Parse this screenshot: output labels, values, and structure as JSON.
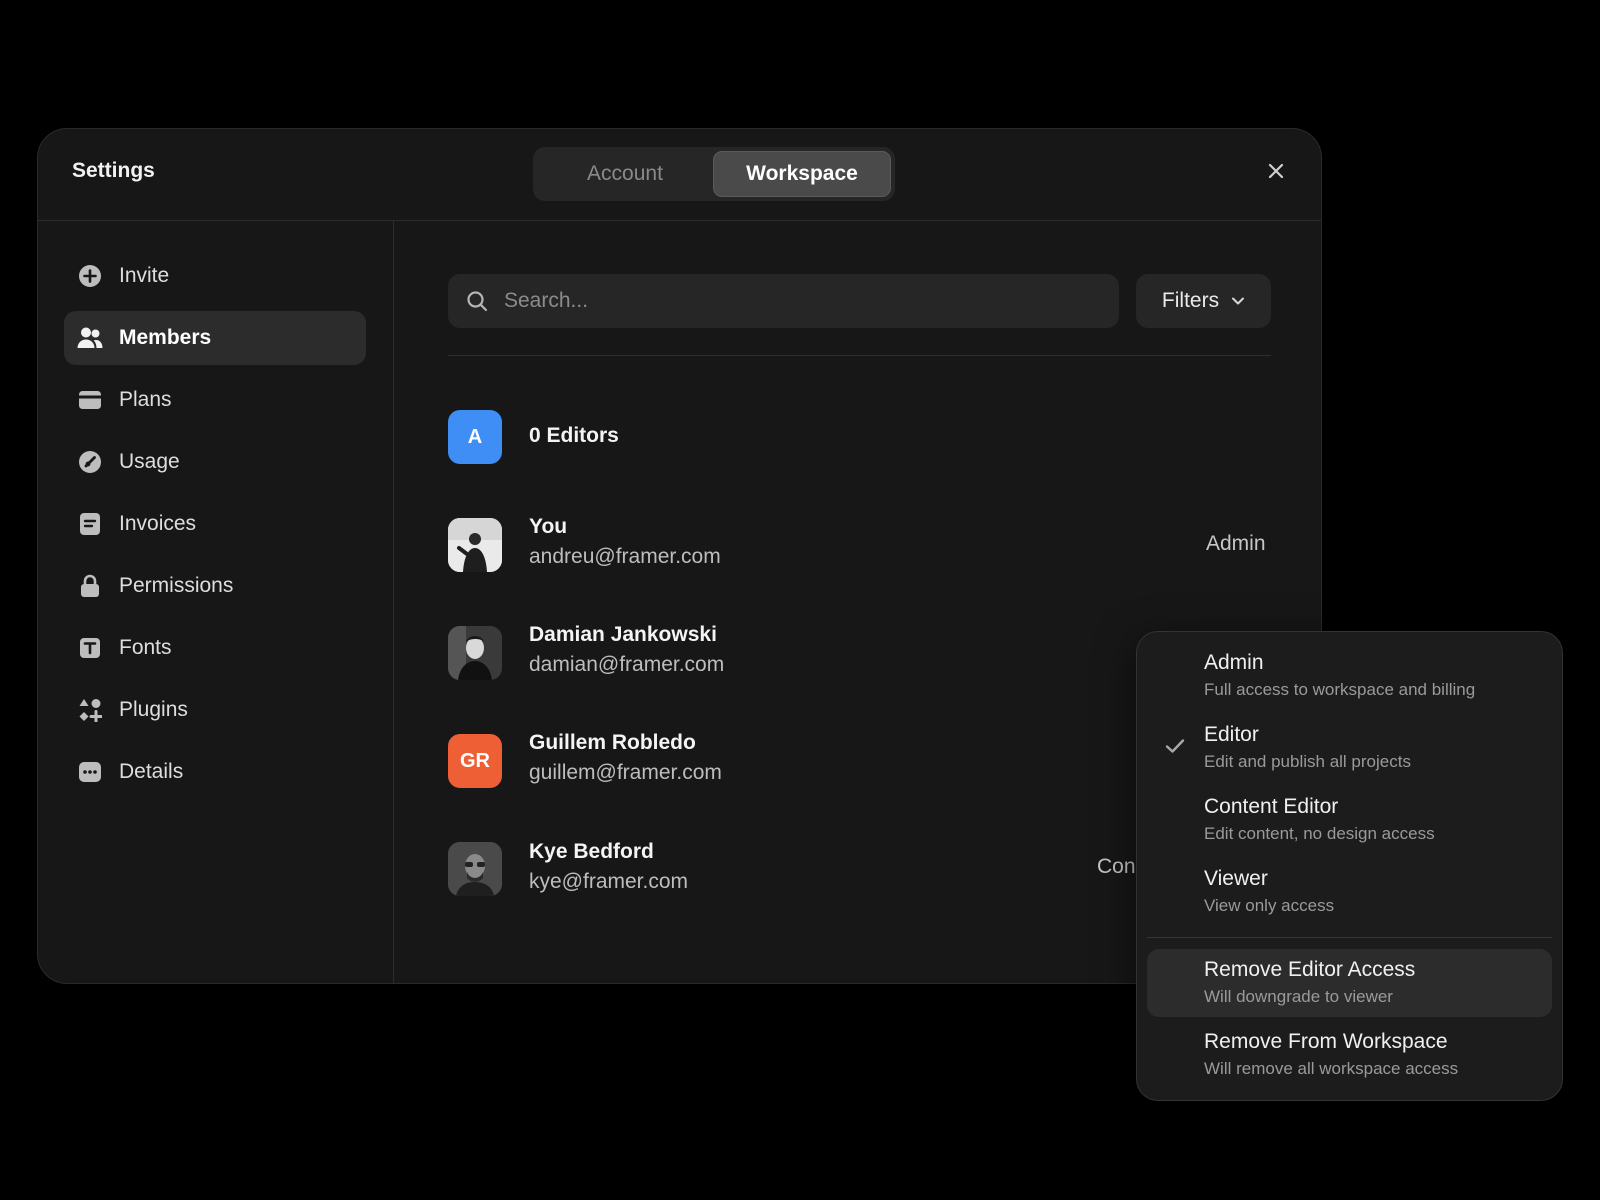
{
  "window": {
    "title": "Settings",
    "tabs": [
      {
        "label": "Account",
        "active": false
      },
      {
        "label": "Workspace",
        "active": true
      }
    ]
  },
  "sidebar": {
    "items": [
      {
        "label": "Invite",
        "icon": "plus-circle-icon"
      },
      {
        "label": "Members",
        "icon": "users-icon",
        "active": true
      },
      {
        "label": "Plans",
        "icon": "credit-card-icon"
      },
      {
        "label": "Usage",
        "icon": "gauge-icon"
      },
      {
        "label": "Invoices",
        "icon": "invoice-icon"
      },
      {
        "label": "Permissions",
        "icon": "lock-icon"
      },
      {
        "label": "Fonts",
        "icon": "text-icon"
      },
      {
        "label": "Plugins",
        "icon": "plugins-icon"
      },
      {
        "label": "Details",
        "icon": "more-icon"
      }
    ]
  },
  "search": {
    "placeholder": "Search..."
  },
  "filters": {
    "label": "Filters"
  },
  "members": {
    "group_label": "0 Editors",
    "group_avatar": "A",
    "list": [
      {
        "name": "You",
        "email": "andreu@framer.com",
        "role": "Admin"
      },
      {
        "name": "Damian Jankowski",
        "email": "damian@framer.com",
        "role": ""
      },
      {
        "name": "Guillem Robledo",
        "email": "guillem@framer.com",
        "role": "",
        "initials": "GR"
      },
      {
        "name": "Kye Bedford",
        "email": "kye@framer.com",
        "role": "Con"
      }
    ]
  },
  "role_menu": {
    "options": [
      {
        "title": "Admin",
        "desc": "Full access to workspace and billing"
      },
      {
        "title": "Editor",
        "desc": "Edit and publish all projects",
        "checked": true
      },
      {
        "title": "Content Editor",
        "desc": "Edit content, no design access"
      },
      {
        "title": "Viewer",
        "desc": "View only access"
      }
    ],
    "actions": [
      {
        "title": "Remove Editor Access",
        "desc": "Will downgrade to viewer",
        "highlighted": true
      },
      {
        "title": "Remove From Workspace",
        "desc": "Will remove all workspace access"
      }
    ]
  },
  "colors": {
    "accent_blue": "#3f8ef5",
    "accent_orange": "#ee5f35",
    "background": "#000000",
    "panel": "#171717"
  }
}
